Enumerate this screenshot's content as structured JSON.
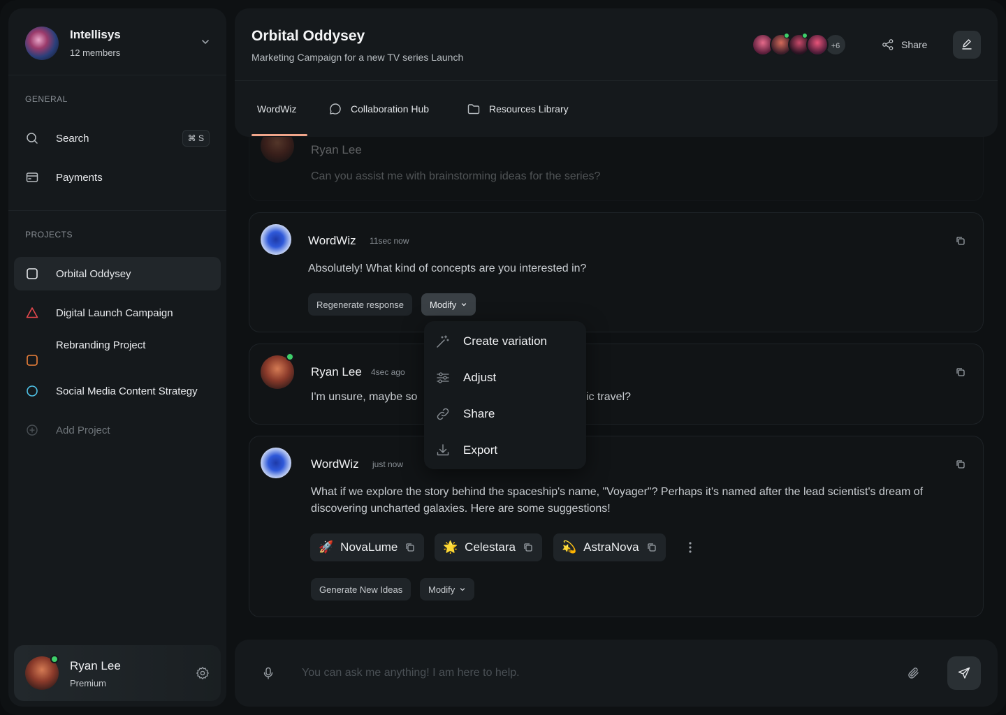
{
  "workspace": {
    "name": "Intellisys",
    "members": "12 members"
  },
  "sidebar": {
    "general_label": "GENERAL",
    "search_label": "Search",
    "search_shortcut": "⌘ S",
    "payments_label": "Payments",
    "projects_label": "PROJECTS",
    "projects": [
      {
        "label": "Orbital Oddysey",
        "color": "#e8eaed"
      },
      {
        "label": "Digital Launch Campaign",
        "color": "#e5484d"
      },
      {
        "label": "Rebranding Project",
        "color": "#f0823a"
      },
      {
        "label": "Social Media Content Strategy",
        "color": "#4fc3e8"
      }
    ],
    "add_project_label": "Add Project"
  },
  "user": {
    "name": "Ryan Lee",
    "plan": "Premium"
  },
  "header": {
    "title": "Orbital Oddysey",
    "subtitle": "Marketing Campaign for a new TV series Launch",
    "extra_members": "+6",
    "share_label": "Share"
  },
  "tabs": [
    {
      "label": "WordWiz"
    },
    {
      "label": "Collaboration Hub"
    },
    {
      "label": "Resources Library"
    }
  ],
  "messages": {
    "faded": {
      "name": "Ryan Lee",
      "text": "Can you assist me with brainstorming ideas for the series?"
    },
    "bot1": {
      "name": "WordWiz",
      "time": "11sec now",
      "text": "Absolutely! What kind of concepts are you interested in?",
      "regenerate_label": "Regenerate response",
      "modify_label": "Modify"
    },
    "user1": {
      "name": "Ryan Lee",
      "time": "4sec ago",
      "text_start": "I'm unsure, maybe so",
      "text_end": "ic travel?"
    },
    "bot2": {
      "name": "WordWiz",
      "time": "just now",
      "text": "What if we explore the story behind the spaceship's name, \"Voyager\"? Perhaps it's named after the lead scientist's dream of discovering uncharted galaxies. Here are some suggestions!",
      "suggestions": [
        {
          "emoji": "🚀",
          "label": "NovaLume"
        },
        {
          "emoji": "🌟",
          "label": "Celestara"
        },
        {
          "emoji": "💫",
          "label": "AstraNova"
        }
      ],
      "generate_label": "Generate New Ideas",
      "modify_label": "Modify"
    }
  },
  "dropdown": [
    {
      "label": "Create variation",
      "icon": "magic-wand-icon"
    },
    {
      "label": "Adjust",
      "icon": "sliders-icon"
    },
    {
      "label": "Share",
      "icon": "link-icon"
    },
    {
      "label": "Export",
      "icon": "download-icon"
    }
  ],
  "composer": {
    "placeholder": "You can ask me anything! I am here to help."
  }
}
